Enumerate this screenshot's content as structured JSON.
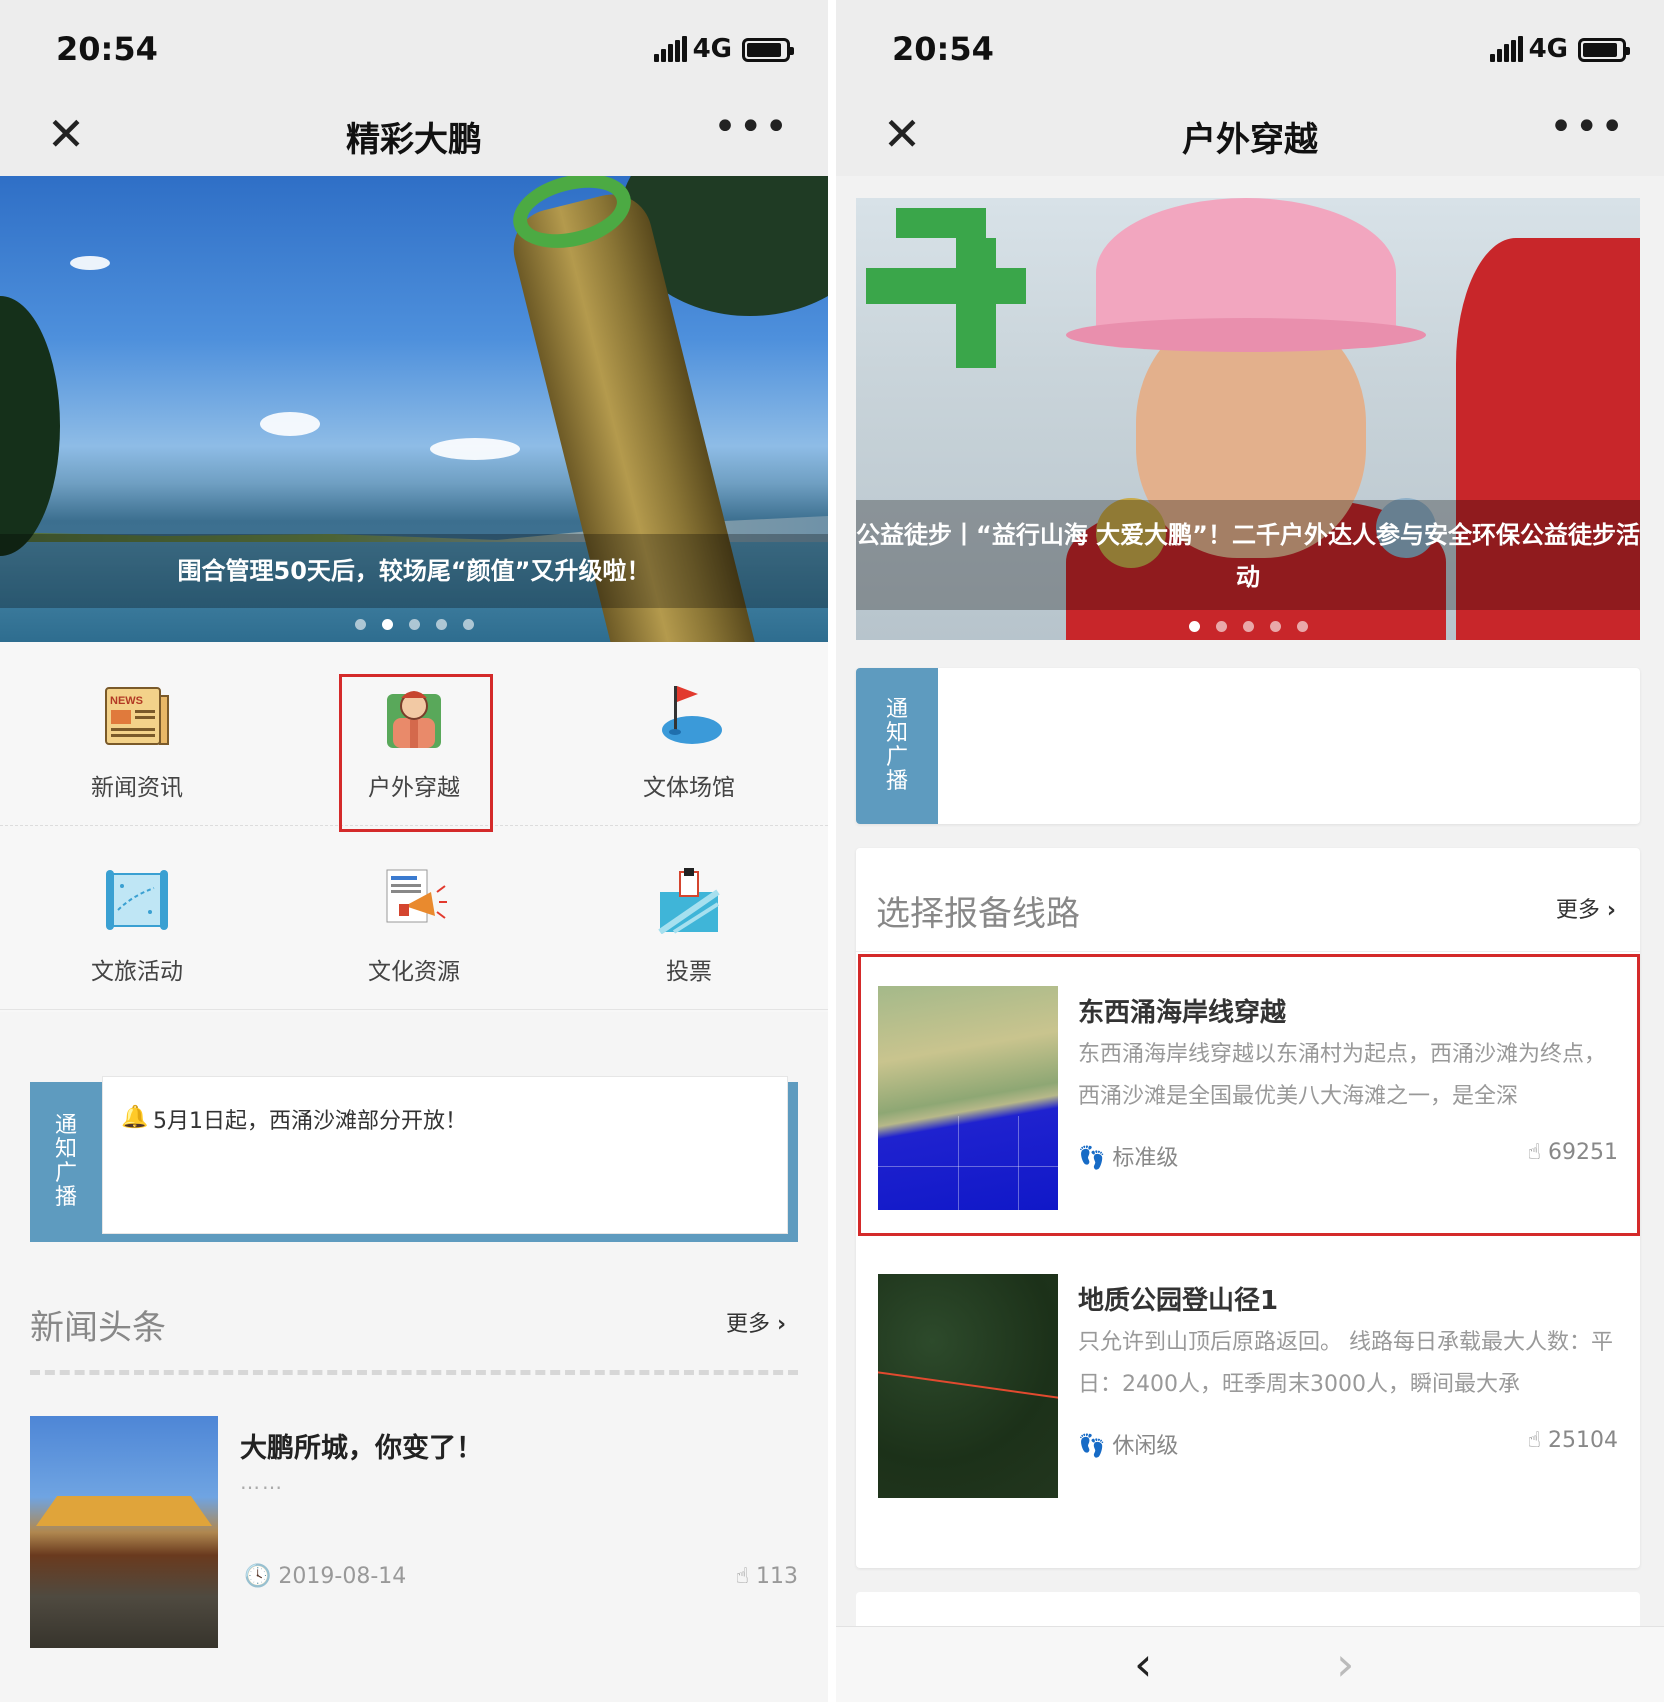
{
  "left": {
    "status": {
      "time": "20:54",
      "network": "4G"
    },
    "nav": {
      "title": "精彩大鹏",
      "close_icon": "close-icon",
      "more_icon": "more-icon"
    },
    "banner": {
      "caption": "围合管理50天后，较场尾“颜值”又升级啦！",
      "dots": 5,
      "active_dot": 2
    },
    "grid": [
      {
        "label": "新闻资讯",
        "icon": "news-icon"
      },
      {
        "label": "户外穿越",
        "icon": "hiker-icon"
      },
      {
        "label": "文体场馆",
        "icon": "golf-flag-icon"
      },
      {
        "label": "文旅活动",
        "icon": "map-scroll-icon"
      },
      {
        "label": "文化资源",
        "icon": "megaphone-icon"
      },
      {
        "label": "投票",
        "icon": "ballot-box-icon"
      }
    ],
    "notice": {
      "tag": "通知广播",
      "text": "5月1日起，西涌沙滩部分开放！"
    },
    "headlines": {
      "title": "新闻头条",
      "more": "更多",
      "items": [
        {
          "title": "大鹏所城，你变了！",
          "summary": "……",
          "date": "2019-08-14",
          "views": "113"
        }
      ]
    }
  },
  "right": {
    "status": {
      "time": "20:54",
      "network": "4G"
    },
    "nav": {
      "title": "户外穿越",
      "close_icon": "close-icon",
      "more_icon": "more-icon"
    },
    "banner": {
      "caption": "公益徒步丨“益行山海 大爱大鹏”！二千户外达人参与安全环保公益徒步活动",
      "dots": 5,
      "active_dot": 1
    },
    "notice": {
      "tag": "通知广播",
      "text": ""
    },
    "routes": {
      "title": "选择报备线路",
      "more": "更多",
      "items": [
        {
          "title": "东西涌海岸线穿越",
          "desc": "东西涌海岸线穿越以东涌村为起点，西涌沙滩为终点，西涌沙滩是全国最优美八大海滩之一，是全深",
          "level": "标准级",
          "count": "69251"
        },
        {
          "title": "地质公园登山径1",
          "desc": "只允许到山顶后原路返回。 线路每日承载最大人数：平日：2400人，旺季周末3000人，瞬间最大承",
          "level": "休闲级",
          "count": "25104"
        }
      ]
    }
  },
  "colors": {
    "notice_blue": "#5e9bbf",
    "highlight_red": "#d42a2a",
    "navbar_bg": "#ededed"
  }
}
